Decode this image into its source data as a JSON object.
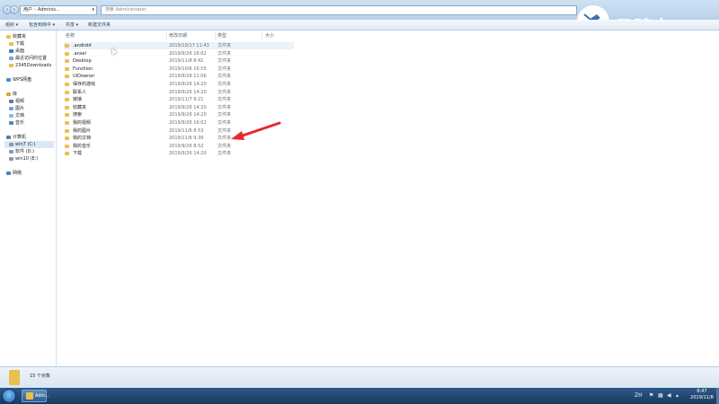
{
  "window": {
    "address": [
      "用户",
      "Adminis..."
    ],
    "search_placeholder": "搜索 Administrator"
  },
  "toolbar": {
    "organize": "组织 ▾",
    "include_library": "包含到库中 ▾",
    "share": "共享 ▾",
    "new_folder": "新建文件夹"
  },
  "nav": {
    "favorites": "收藏夹",
    "favorites_items": [
      "下载",
      "桌面",
      "最近访问的位置",
      "2345Downloads"
    ],
    "wps": "WPS网盘",
    "libraries": "库",
    "library_items": [
      "视频",
      "图片",
      "文档",
      "音乐"
    ],
    "computer": "计算机",
    "drives": [
      "win7 (C:)",
      "软件 (D:)",
      "win10 (E:)"
    ],
    "network": "网络"
  },
  "columns": {
    "name": "名称",
    "date": "修改日期",
    "type": "类型",
    "size": "大小"
  },
  "files": [
    {
      "name": ".android",
      "date": "2019/10/17 11:43",
      "type": "文件夹"
    },
    {
      "name": ".ansel",
      "date": "2019/9/26 16:02",
      "type": "文件夹"
    },
    {
      "name": "Desktop",
      "date": "2019/11/8 8:41",
      "type": "文件夹"
    },
    {
      "name": "Funshion",
      "date": "2019/10/6 16:55",
      "type": "文件夹"
    },
    {
      "name": "UIDowner",
      "date": "2019/9/28 11:06",
      "type": "文件夹"
    },
    {
      "name": "保存的游戏",
      "date": "2019/9/26 14:20",
      "type": "文件夹"
    },
    {
      "name": "联系人",
      "date": "2019/9/26 14:20",
      "type": "文件夹"
    },
    {
      "name": "链接",
      "date": "2019/11/7 9:21",
      "type": "文件夹"
    },
    {
      "name": "收藏夹",
      "date": "2019/9/26 14:20",
      "type": "文件夹"
    },
    {
      "name": "搜索",
      "date": "2019/9/26 14:20",
      "type": "文件夹"
    },
    {
      "name": "我的视频",
      "date": "2019/9/26 16:02",
      "type": "文件夹"
    },
    {
      "name": "我的图片",
      "date": "2019/11/6 8:53",
      "type": "文件夹"
    },
    {
      "name": "我的文档",
      "date": "2019/11/6 9:39",
      "type": "文件夹"
    },
    {
      "name": "我的音乐",
      "date": "2019/9/26 8:52",
      "type": "文件夹"
    },
    {
      "name": "下载",
      "date": "2019/9/26 14:20",
      "type": "文件夹"
    }
  ],
  "status": {
    "count": "15 个对象"
  },
  "taskbar": {
    "explorer_label": "Adm...",
    "time": "8:47",
    "date": "2019/11/8",
    "tray_lang": "ZH"
  },
  "watermark": {
    "text": "云骑士"
  },
  "colors": {
    "folder": "#e8c04f",
    "arrow": "#e8262b",
    "taskbar": "#1f4670"
  }
}
